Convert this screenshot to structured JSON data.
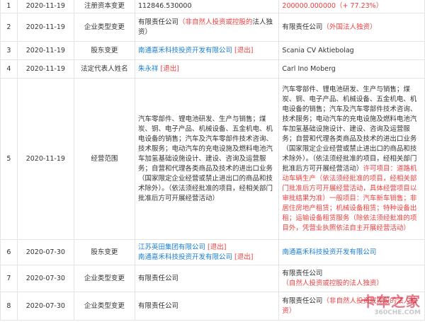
{
  "rows": [
    {
      "idx": "1",
      "date": "2020-11-19",
      "type": "注册资本变更",
      "before": [
        {
          "t": "112846.530000",
          "c": "gray"
        }
      ],
      "after": [
        {
          "t": "200000.000000",
          "c": "red"
        },
        {
          "t": "（+ 77.23%）",
          "c": "red"
        }
      ]
    },
    {
      "idx": "2",
      "date": "2020-11-19",
      "type": "企业类型变更",
      "before": [
        {
          "t": "有限责任公司",
          "c": "gray"
        },
        {
          "t": "（非自然人投资或控股的",
          "c": "red"
        },
        {
          "t": "法人独资）",
          "c": "gray"
        }
      ],
      "after": [
        {
          "t": "有限责任公司",
          "c": "gray"
        },
        {
          "t": "（外国法人独资）",
          "c": "red"
        }
      ]
    },
    {
      "idx": "3",
      "date": "2020-11-19",
      "type": "股东变更",
      "before": [
        {
          "t": "南通嘉禾科技投资开发有限公司",
          "c": "link"
        },
        {
          "t": " [退出]",
          "c": "red"
        }
      ],
      "after": [
        {
          "t": "Scania CV Aktiebolag",
          "c": "gray"
        }
      ]
    },
    {
      "idx": "4",
      "date": "2020-11-19",
      "type": "法定代表人姓名",
      "before": [
        {
          "t": "朱永祥",
          "c": "link"
        },
        {
          "t": " [退出]",
          "c": "red"
        }
      ],
      "after": [
        {
          "t": "Carl Ino Moberg",
          "c": "gray"
        }
      ]
    },
    {
      "idx": "5",
      "date": "2020-11-19",
      "type": "经营范围",
      "before": [
        {
          "t": "汽车零部件、锂电池研发、生产与销售；煤炭、铜、电子产品、机械设备、五金机电、机电设备的销售；汽车及汽车零部件技术咨询、技术服务；电动汽车的充电设施及燃料电池汽车加氢基础设施设计、建设、咨询及运营服务；自营和代理各类商品及技术的进出口业务（国家限定企业经营或禁止进出口的商品和技术除外）。（依法须经批准的项目，经相关部门批准后方可开展经营活动）",
          "c": "gray"
        }
      ],
      "after": [
        {
          "t": "汽车零部件、锂电池研发、生产与销售；煤炭、铜、电子产品、机械设备、五金机电、机电设备的销售；汽车及汽车零部件技术咨询、技术服务；电动汽车的充电设施及燃料电池汽车加氢基础设施设计、建设、咨询及运营服务；自营和代理各类商品及技术的进出口业务（国家限定企业经营或禁止进出口的商品和技术除外）。（依法须经批准的项目，经相关部门批准后方可开展经营活动）",
          "c": "gray"
        },
        {
          "t": "许可项目：道路机动车辆生产（依法须经批准的项目，经相关部门批准后方可开展经营活动，具体经营项目以审批结果为准）一般项目：汽车新车销售；非居住房地产租赁；机械设备租赁；特种设备出租；运输设备租赁服务（除依法须经批准的项目外，凭营业执照依法自主开展经营活动）",
          "c": "red"
        }
      ]
    },
    {
      "idx": "6",
      "date": "2020-07-30",
      "type": "股东变更",
      "before": [
        {
          "t": "江苏英田集团有限公司",
          "c": "link"
        },
        {
          "t": " [退出]",
          "c": "red"
        },
        {
          "t": "南通嘉禾科技投资开发有限公司",
          "c": "link"
        },
        {
          "t": " [退出]",
          "c": "red"
        }
      ],
      "after": [
        {
          "t": "南通嘉禾科技投资开发有限公司",
          "c": "link"
        }
      ]
    },
    {
      "idx": "7",
      "date": "2020-07-30",
      "type": "企业类型变更",
      "before": [
        {
          "t": "有限责任公司",
          "c": "gray"
        }
      ],
      "after": [
        {
          "t": "有限责任公司",
          "c": "gray"
        },
        {
          "t": "（自然人投资或控股的法人独资）",
          "c": "red"
        }
      ]
    },
    {
      "idx": "8",
      "date": "2020-07-30",
      "type": "企业类型变更",
      "before": [
        {
          "t": "有限责任公司",
          "c": "gray"
        }
      ],
      "after": [
        {
          "t": "有限责任公司",
          "c": "gray"
        },
        {
          "t": "（非自然人投资或控股的法人独资）",
          "c": "red"
        }
      ]
    }
  ],
  "watermark": {
    "cn": "卡车之家",
    "en": "360CHE.COM"
  },
  "colors": {
    "red": "#ee3e3e",
    "link": "#1a7ed6",
    "text": "#333333",
    "border": "#e4e4e4"
  }
}
